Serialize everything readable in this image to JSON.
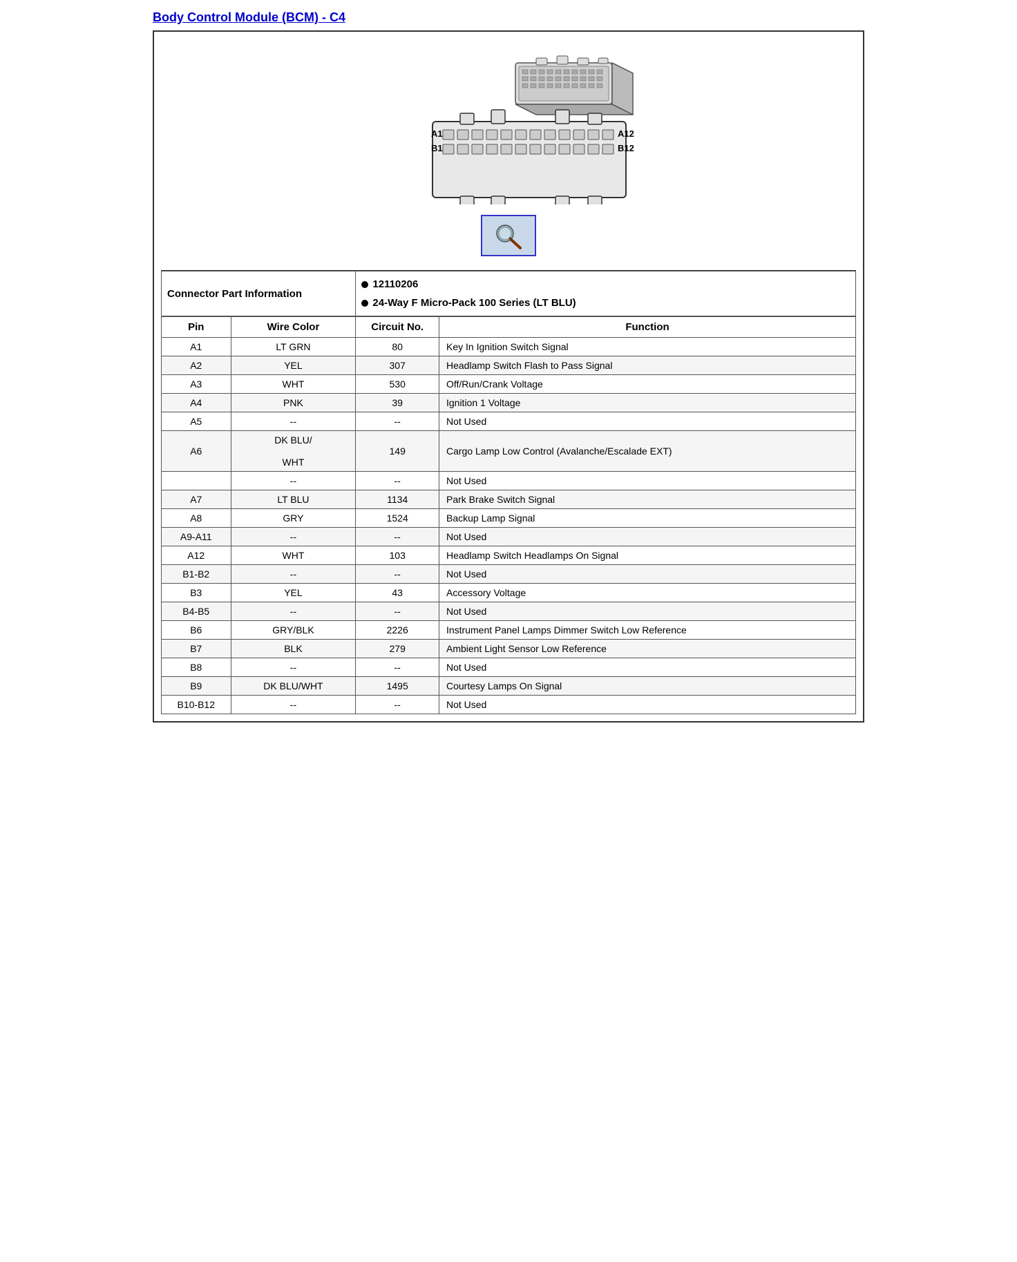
{
  "page": {
    "title": "Body Control Module (BCM) - C4"
  },
  "connector_info": {
    "label": "Connector Part Information",
    "parts": [
      "12110206",
      "24-Way F Micro-Pack 100 Series (LT BLU)"
    ]
  },
  "table_headers": {
    "pin": "Pin",
    "wire_color": "Wire Color",
    "circuit_no": "Circuit No.",
    "function": "Function"
  },
  "pins": [
    {
      "pin": "A1",
      "wire_color": "LT GRN",
      "circuit_no": "80",
      "function": "Key In Ignition Switch Signal"
    },
    {
      "pin": "A2",
      "wire_color": "YEL",
      "circuit_no": "307",
      "function": "Headlamp Switch Flash to Pass Signal"
    },
    {
      "pin": "A3",
      "wire_color": "WHT",
      "circuit_no": "530",
      "function": "Off/Run/Crank Voltage"
    },
    {
      "pin": "A4",
      "wire_color": "PNK",
      "circuit_no": "39",
      "function": "Ignition 1 Voltage"
    },
    {
      "pin": "A5",
      "wire_color": "--",
      "circuit_no": "--",
      "function": "Not Used"
    },
    {
      "pin": "A6",
      "wire_color": "DK BLU/\nWHT",
      "circuit_no": "149",
      "function": "Cargo Lamp Low Control (Avalanche/Escalade EXT)"
    },
    {
      "pin": "",
      "wire_color": "--",
      "circuit_no": "--",
      "function": "Not Used"
    },
    {
      "pin": "A7",
      "wire_color": "LT BLU",
      "circuit_no": "1134",
      "function": "Park Brake Switch Signal"
    },
    {
      "pin": "A8",
      "wire_color": "GRY",
      "circuit_no": "1524",
      "function": "Backup Lamp Signal"
    },
    {
      "pin": "A9-A11",
      "wire_color": "--",
      "circuit_no": "--",
      "function": "Not Used"
    },
    {
      "pin": "A12",
      "wire_color": "WHT",
      "circuit_no": "103",
      "function": "Headlamp Switch Headlamps On Signal"
    },
    {
      "pin": "B1-B2",
      "wire_color": "--",
      "circuit_no": "--",
      "function": "Not Used"
    },
    {
      "pin": "B3",
      "wire_color": "YEL",
      "circuit_no": "43",
      "function": "Accessory Voltage"
    },
    {
      "pin": "B4-B5",
      "wire_color": "--",
      "circuit_no": "--",
      "function": "Not Used"
    },
    {
      "pin": "B6",
      "wire_color": "GRY/BLK",
      "circuit_no": "2226",
      "function": "Instrument Panel Lamps Dimmer Switch Low Reference"
    },
    {
      "pin": "B7",
      "wire_color": "BLK",
      "circuit_no": "279",
      "function": "Ambient Light Sensor Low Reference"
    },
    {
      "pin": "B8",
      "wire_color": "--",
      "circuit_no": "--",
      "function": "Not Used"
    },
    {
      "pin": "B9",
      "wire_color": "DK BLU/WHT",
      "circuit_no": "1495",
      "function": "Courtesy Lamps On Signal"
    },
    {
      "pin": "B10-B12",
      "wire_color": "--",
      "circuit_no": "--",
      "function": "Not Used"
    }
  ],
  "magnify_label": "magnify",
  "connector_labels": {
    "A1": "A1",
    "A12": "A12",
    "B1": "B1",
    "B12": "B12"
  }
}
